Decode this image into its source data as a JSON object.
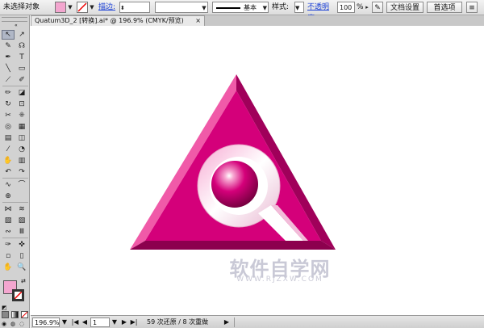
{
  "control_bar": {
    "selection_label": "未选择对象",
    "fill_color": "#f3a6cf",
    "stroke_label": "描边:",
    "stroke_style": "基本",
    "style_label": "样式:",
    "opacity_label": "不透明度:",
    "opacity_value": "100",
    "opacity_unit": "%",
    "doc_setup_button": "文档设置",
    "preferences_button": "首选项"
  },
  "document_tab": {
    "title": "Quatum3D_2 [转换].ai* @ 196.9% (CMYK/预览)",
    "close": "×"
  },
  "tools": [
    "↖",
    "↗",
    "✎",
    "☊",
    "✒",
    "T",
    "╲",
    "▭",
    "⟋",
    "✐",
    "✏",
    "◪",
    "↻",
    "⊡",
    "✂",
    "⁜",
    "◎",
    "▦",
    "▤",
    "◫",
    "⁄",
    "◔",
    "✋",
    "▥",
    "↶",
    "↷",
    "∿",
    "⌒",
    "⊕",
    "",
    "⋈",
    "≋",
    "▧",
    "▨",
    "∾",
    "Ⅲ",
    "✑",
    "✜",
    "▫",
    "▯",
    "✋",
    "🔍"
  ],
  "swatches": {
    "fill_color": "#f3a6cf",
    "stroke_color": "#ffffff"
  },
  "artwork": {
    "colors": {
      "magenta": "#d4007a",
      "magenta_dark": "#a0005a",
      "magenta_light": "#f05aa8",
      "magenta_pale": "#f7a9d2"
    }
  },
  "watermark": {
    "main": "软件自学网",
    "url": "WWW.RJZXW.COM",
    "color": "#c9c9d6"
  },
  "status_bar": {
    "zoom": "196.9%",
    "page": "1",
    "history": "59 次还原 / 8 次重做"
  }
}
